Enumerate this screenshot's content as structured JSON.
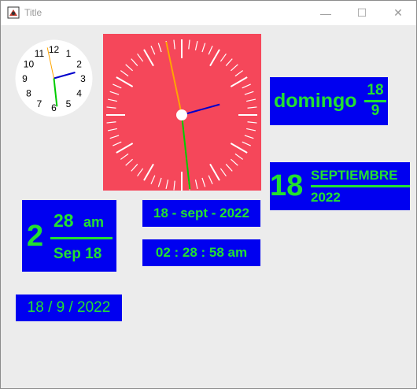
{
  "window": {
    "title": "Title",
    "controls": {
      "minimize": "—",
      "maximize": "☐",
      "close": "✕"
    }
  },
  "analog_small": {
    "numbers": [
      "12",
      "1",
      "2",
      "3",
      "4",
      "5",
      "6",
      "7",
      "8",
      "9",
      "10",
      "11"
    ],
    "time": {
      "hours": 2,
      "minutes": 28,
      "seconds": 58
    },
    "colors": {
      "face": "#ffffff",
      "hour_hand": "#0000cc",
      "minute_hand": "#00cc00",
      "second_hand": "#ffa500",
      "numbers": "#000000"
    }
  },
  "analog_big": {
    "time": {
      "hours": 2,
      "minutes": 28,
      "seconds": 58
    },
    "colors": {
      "face": "#f5475a",
      "ticks": "#ffffff",
      "hour_hand": "#0000cc",
      "minute_hand": "#00cc00",
      "second_hand": "#ffa500",
      "hub": "#ffffff"
    }
  },
  "weekday_panel": {
    "day_name": "domingo",
    "day": "18",
    "month": "9"
  },
  "month_panel": {
    "day": "18",
    "month": "SEPTIEMBRE",
    "year": "2022"
  },
  "time_panel": {
    "hour": "2",
    "minute": "28",
    "ampm": "am",
    "date": "Sep 18"
  },
  "date_line": "18 - sept - 2022",
  "clock_line": "02 : 28 : 58 am",
  "short_date": "18 / 9 / 2022",
  "theme": {
    "panel_bg": "#0000f0",
    "panel_text": "#22e030",
    "window_bg": "#ececec"
  }
}
